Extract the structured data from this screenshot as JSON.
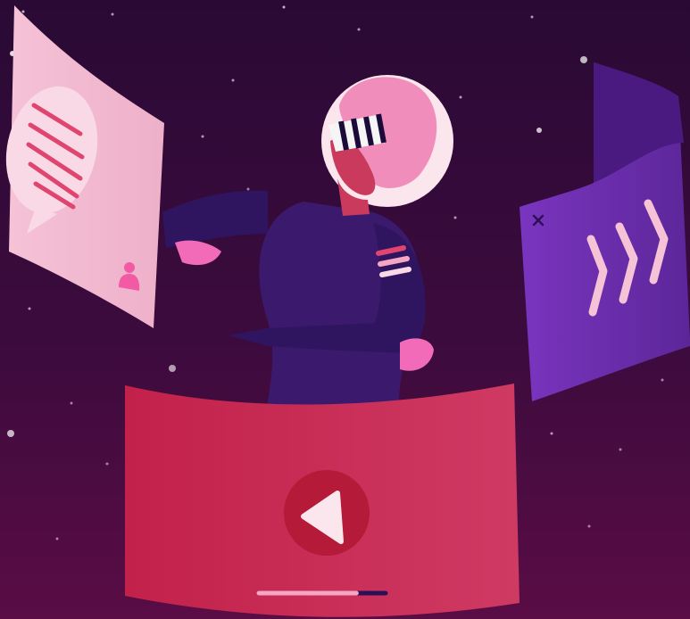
{
  "scene": {
    "colors": {
      "sky_top": "#2a0a35",
      "sky_bottom": "#5a0c45",
      "chat_panel": "#f2b8cf",
      "chat_bubble": "#f9d9e6",
      "chat_lines": "#e0456f",
      "ff_panel": "#6d2fb0",
      "play_panel": "#d4375f",
      "play_button": "#b51a38",
      "suit": "#3b1a6e",
      "hair": "#f08dbb",
      "skin": "#c93a5d",
      "glove": "#f26bb8",
      "progress_fill": "#f4a6c2",
      "progress_rest": "#2b1056"
    },
    "progress": 0.77,
    "icons": {
      "chat_panel": "chat-bubble-icon",
      "user": "user-icon",
      "close": "close-icon",
      "fast_forward": "fast-forward-icon",
      "play": "play-button-icon"
    }
  }
}
